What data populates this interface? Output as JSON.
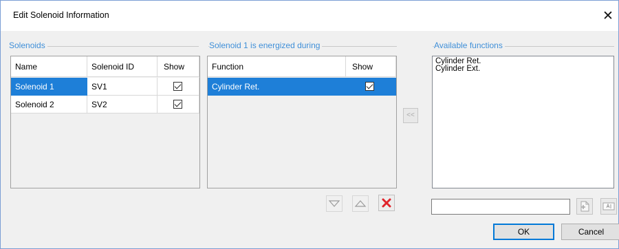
{
  "dialog": {
    "title": "Edit Solenoid Information",
    "close_glyph": "✕"
  },
  "solenoids": {
    "group_label": "Solenoids",
    "columns": [
      "Name",
      "Solenoid ID",
      "Show"
    ],
    "rows": [
      {
        "name": "Solenoid 1",
        "id": "SV1",
        "show": true,
        "selected": true
      },
      {
        "name": "Solenoid 2",
        "id": "SV2",
        "show": true,
        "selected": false
      }
    ]
  },
  "energized": {
    "group_label": "Solenoid 1 is energized during",
    "columns": [
      "Function",
      "Show"
    ],
    "rows": [
      {
        "function": "Cylinder Ret.",
        "show": true,
        "selected": true
      }
    ]
  },
  "move_left_label": "<<",
  "available": {
    "group_label": "Available functions",
    "items": [
      "Cylinder Ret.",
      "Cylinder Ext."
    ]
  },
  "icons": {
    "move_down": "triangle-down-icon",
    "move_up": "triangle-up-icon",
    "delete": "red-x-icon",
    "add": "add-document-icon",
    "rename": "text-field-icon"
  },
  "search": {
    "value": ""
  },
  "buttons": {
    "ok": "OK",
    "cancel": "Cancel"
  },
  "colors": {
    "accent": "#1e7fd8",
    "group_label": "#3f8fd8",
    "delete": "#e0242b"
  }
}
